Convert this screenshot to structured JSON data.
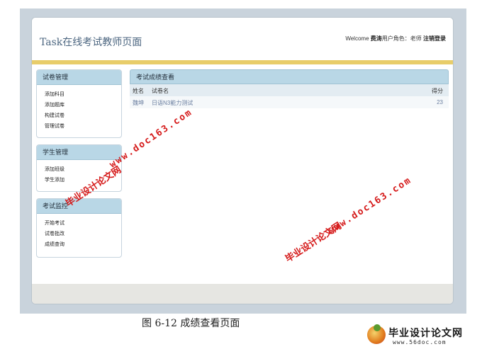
{
  "header": {
    "title": "Task在线考试教师页面",
    "welcome_prefix": "Welcome",
    "user_name": "费涛",
    "role_text": "用户角色：老师",
    "logout_label": "注销登录"
  },
  "sidebar": {
    "panels": [
      {
        "title": "试卷管理",
        "items": [
          "添加科目",
          "添加题库",
          "构建试卷",
          "管理试卷"
        ]
      },
      {
        "title": "学生管理",
        "items": [
          "添加班级",
          "学生添加"
        ]
      },
      {
        "title": "考试监控",
        "items": [
          "开始考试",
          "试卷批改",
          "成绩查询"
        ]
      }
    ]
  },
  "main": {
    "title": "考试成绩查看",
    "columns": {
      "name": "姓名",
      "paper": "试卷名",
      "score": "得分"
    },
    "rows": [
      {
        "name": "魏坤",
        "paper": "日语N3能力测试",
        "score": "23"
      }
    ]
  },
  "caption": "图 6-12  成绩查看页面",
  "watermarks": {
    "site_name": "毕业设计论文网",
    "site_url": "www.doc163.com"
  },
  "brand": {
    "name": "毕业设计论文网",
    "url": "www.56doc.com"
  },
  "colors": {
    "panel_header": "#b9d7e6",
    "header_stripe": "#e8cd6a",
    "watermark": "#d51a1a",
    "background_frame": "#c9d3dc"
  }
}
